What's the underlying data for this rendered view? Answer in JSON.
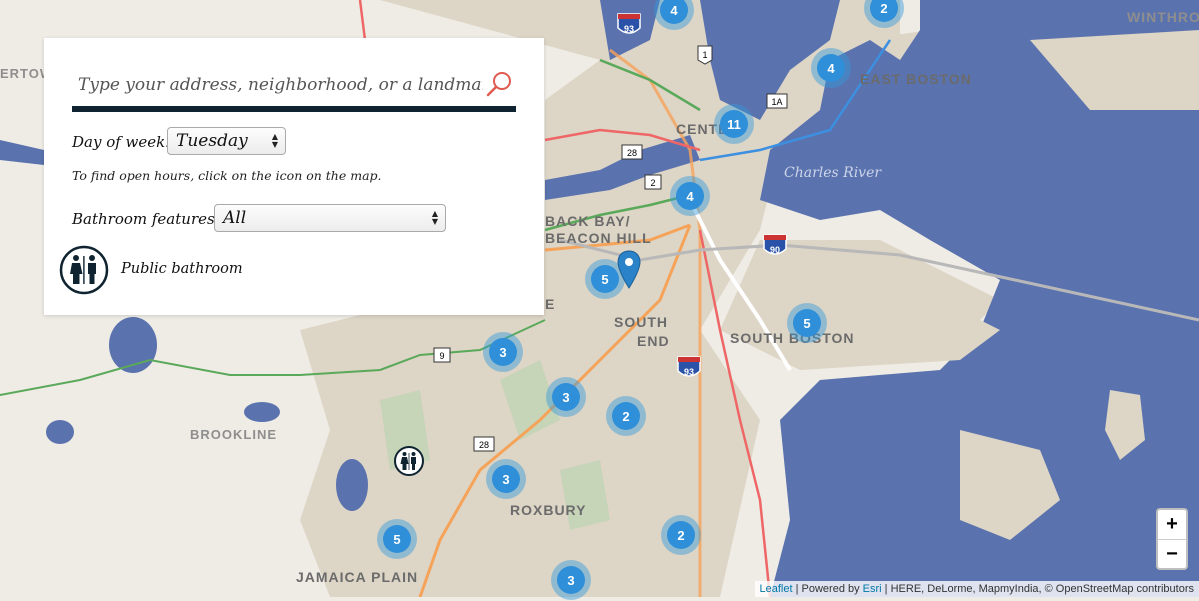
{
  "search": {
    "placeholder": "Type your address, neighborhood, or a landmark",
    "value": ""
  },
  "filters": {
    "day_label": "Day of week:",
    "day_value": "Tuesday",
    "hint": "To find open hours, click on the icon on the map.",
    "features_label": "Bathroom features:",
    "features_value": "All"
  },
  "legend": {
    "label": "Public bathroom",
    "icon": "restroom-icon"
  },
  "map": {
    "labels": {
      "winthrop": "WINTHROP",
      "east_boston": "EAST BOSTON",
      "center": "CENTER",
      "charles_river": "Charles River",
      "back_bay": "BACK BAY/",
      "beacon_hill": "BEACON HILL",
      "south_end_1": "SOUTH",
      "south_end_2": "END",
      "south_boston": "SOUTH BOSTON",
      "brookline": "BROOKLINE",
      "roxbury": "ROXBURY",
      "jamaica_plain": "JAMAICA PLAIN",
      "watertown_fragment": "ERTOWN",
      "back_bay_fragment": "E"
    },
    "shields": {
      "i93_top": "93",
      "route1": "1",
      "route1a": "1A",
      "route28_top": "28",
      "route2": "2",
      "i90": "90",
      "route9": "9",
      "i93_bottom": "93",
      "route28_bottom": "28"
    },
    "clusters": [
      {
        "id": "c1",
        "count": "4"
      },
      {
        "id": "c2",
        "count": "2"
      },
      {
        "id": "c3",
        "count": "4"
      },
      {
        "id": "c4",
        "count": "11"
      },
      {
        "id": "c5",
        "count": "4"
      },
      {
        "id": "c6",
        "count": "5"
      },
      {
        "id": "c7",
        "count": "5"
      },
      {
        "id": "c8",
        "count": "3"
      },
      {
        "id": "c9",
        "count": "3"
      },
      {
        "id": "c10",
        "count": "2"
      },
      {
        "id": "c11",
        "count": "3"
      },
      {
        "id": "c12",
        "count": "5"
      },
      {
        "id": "c13",
        "count": "2"
      },
      {
        "id": "c14",
        "count": "3"
      }
    ],
    "colors": {
      "water": "#5a72ae",
      "land": "#efece6",
      "urban": "#ddd5c6",
      "cluster": "#2f8fd8",
      "panel_accent": "#0f2330",
      "search_icon": "#e05a50"
    }
  },
  "zoom": {
    "in_label": "+",
    "out_label": "−"
  },
  "attribution": {
    "leaflet": "Leaflet",
    "sep1": " | Powered by ",
    "esri": "Esri",
    "rest": " | HERE, DeLorme, MapmyIndia, © OpenStreetMap contributors"
  }
}
